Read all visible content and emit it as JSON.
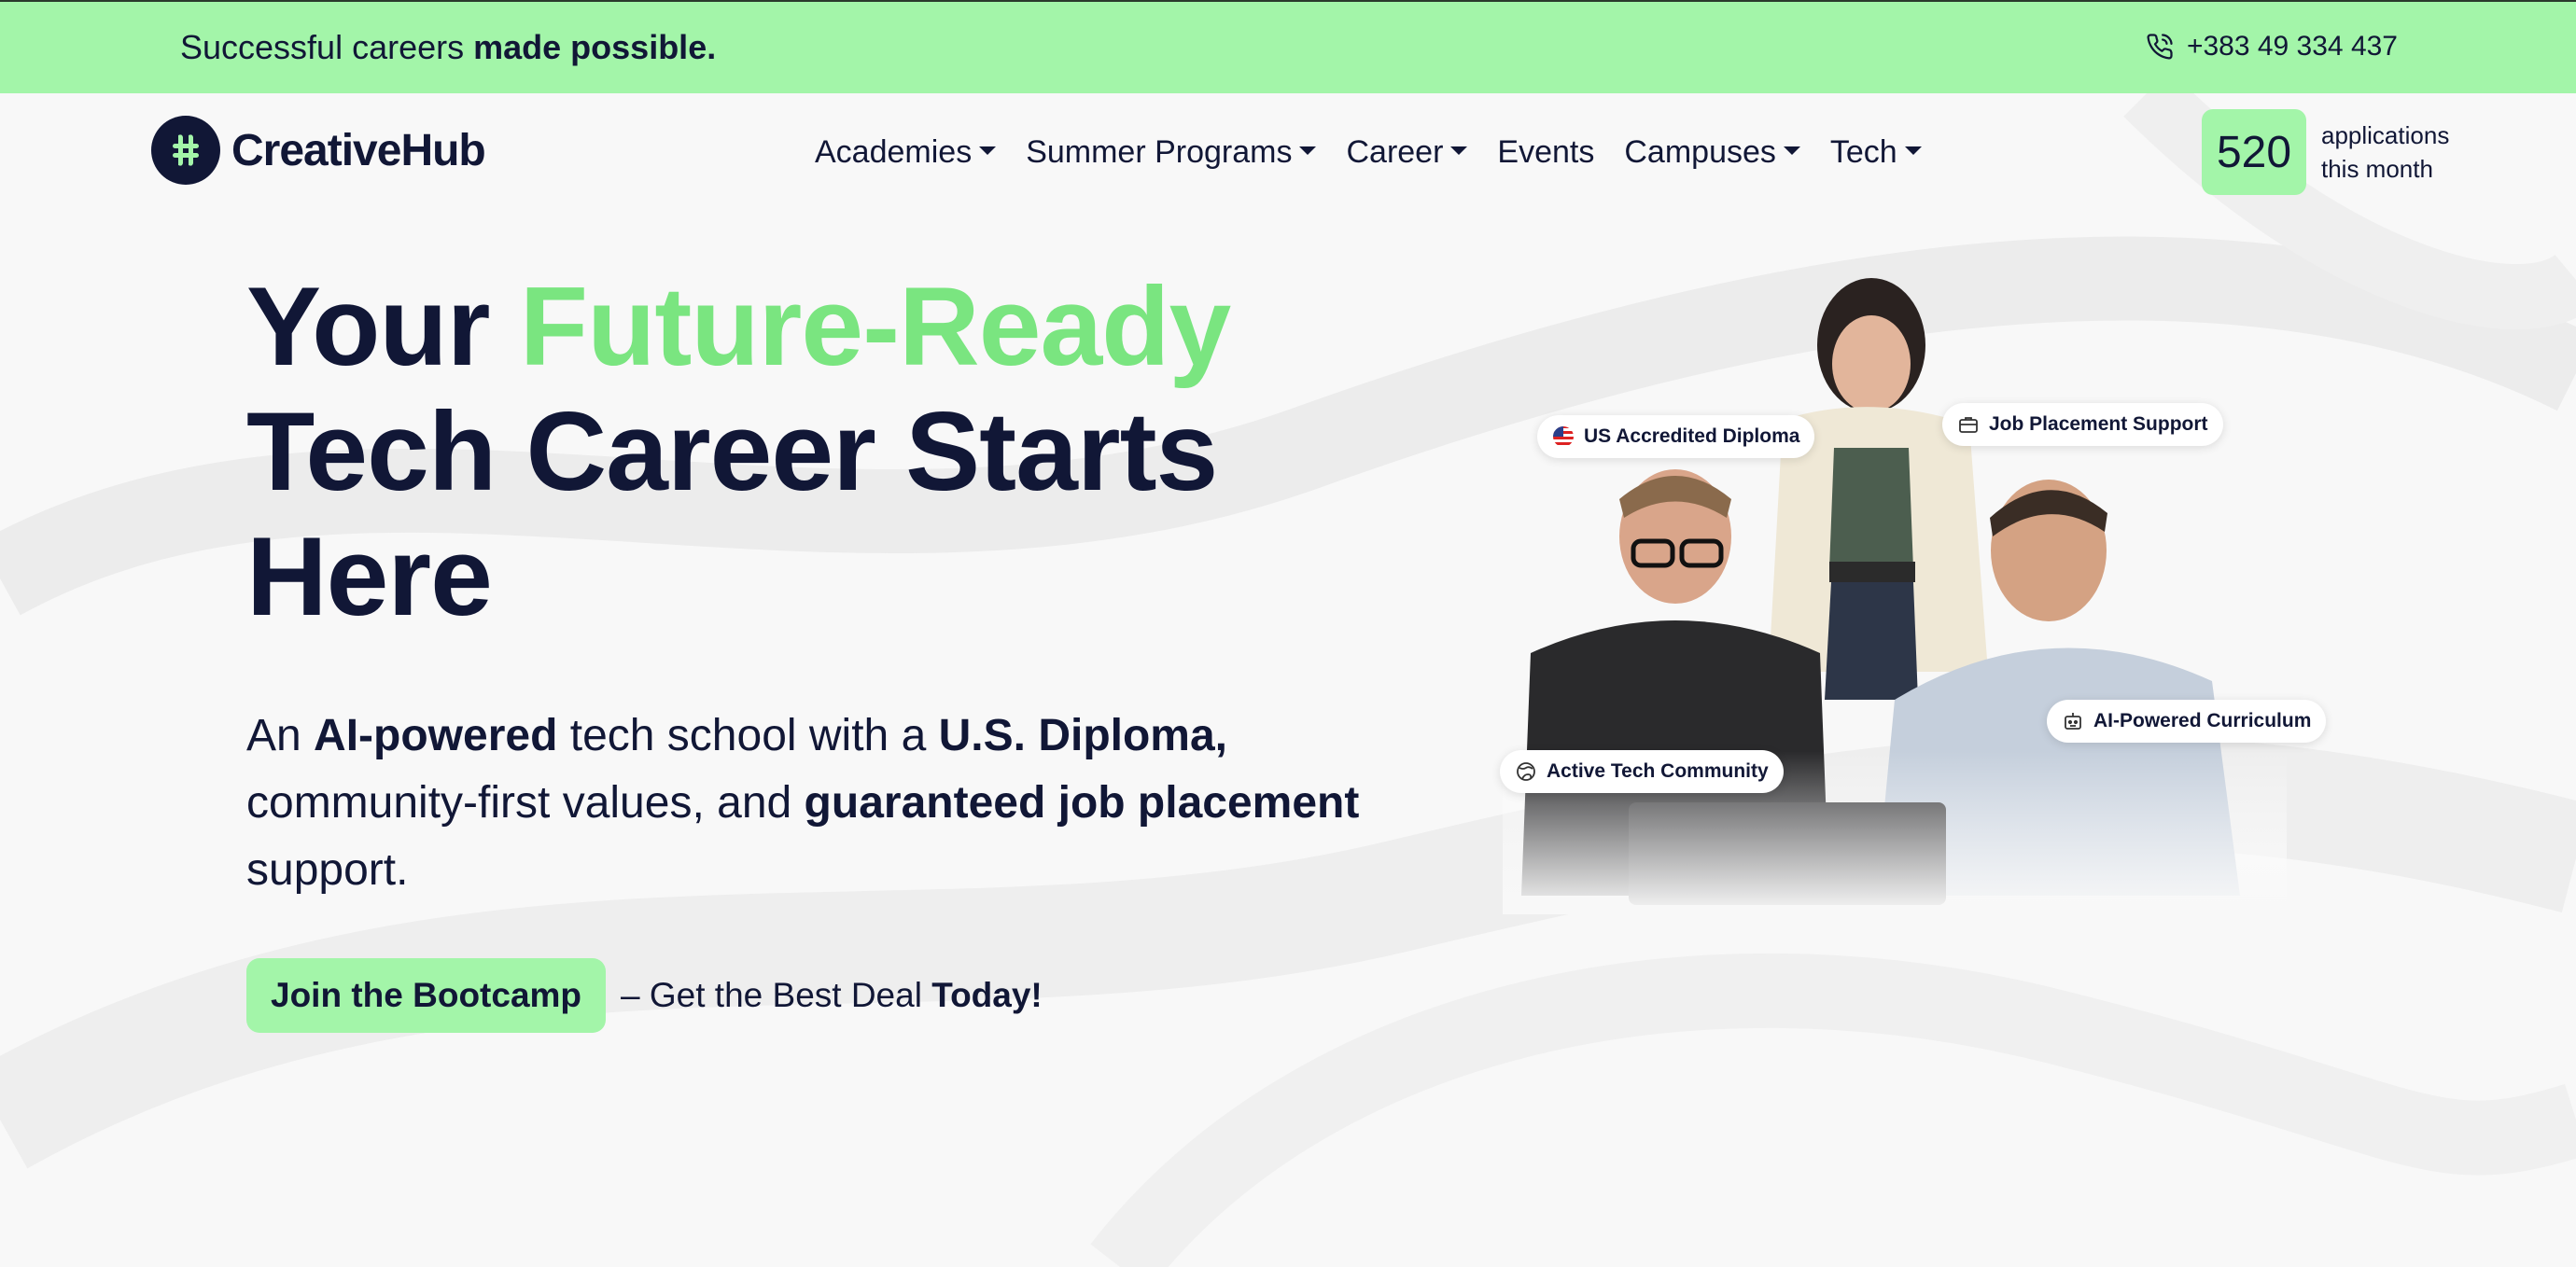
{
  "topbar": {
    "tagline_prefix": "Successful careers ",
    "tagline_bold": "made possible.",
    "phone": "+383 49 334 437",
    "phone_icon": "phone-icon"
  },
  "brand": {
    "name": "CreativeHub",
    "logo_icon": "hash-logo-icon"
  },
  "nav": {
    "items": [
      {
        "label": "Academies",
        "dropdown": true
      },
      {
        "label": "Summer Programs",
        "dropdown": true
      },
      {
        "label": "Career",
        "dropdown": true
      },
      {
        "label": "Events",
        "dropdown": false
      },
      {
        "label": "Campuses",
        "dropdown": true
      },
      {
        "label": "Tech",
        "dropdown": true
      }
    ]
  },
  "applications": {
    "count": "520",
    "label_line1": "applications",
    "label_line2": "this month"
  },
  "hero": {
    "title_part1": "Your ",
    "title_accent": "Future-Ready",
    "title_part2": "Tech Career Starts",
    "title_part3": "Here",
    "sub_1": "An ",
    "sub_2": "AI-powered",
    "sub_3": " tech school with a ",
    "sub_4": "U.S. Diploma,",
    "sub_5": "community-first values, and ",
    "sub_6": "guaranteed job placement",
    "sub_7": "support."
  },
  "cta": {
    "button": "Join the Bootcamp",
    "note_prefix": "– Get the Best Deal ",
    "note_bold": "Today!"
  },
  "chips": {
    "diploma": "US Accredited Diploma",
    "placement": "Job Placement Support",
    "community": "Active Tech Community",
    "curriculum": "AI-Powered Curriculum"
  },
  "colors": {
    "accent": "#a3f5a9",
    "accent_text": "#7ae580",
    "navy": "#111736"
  }
}
